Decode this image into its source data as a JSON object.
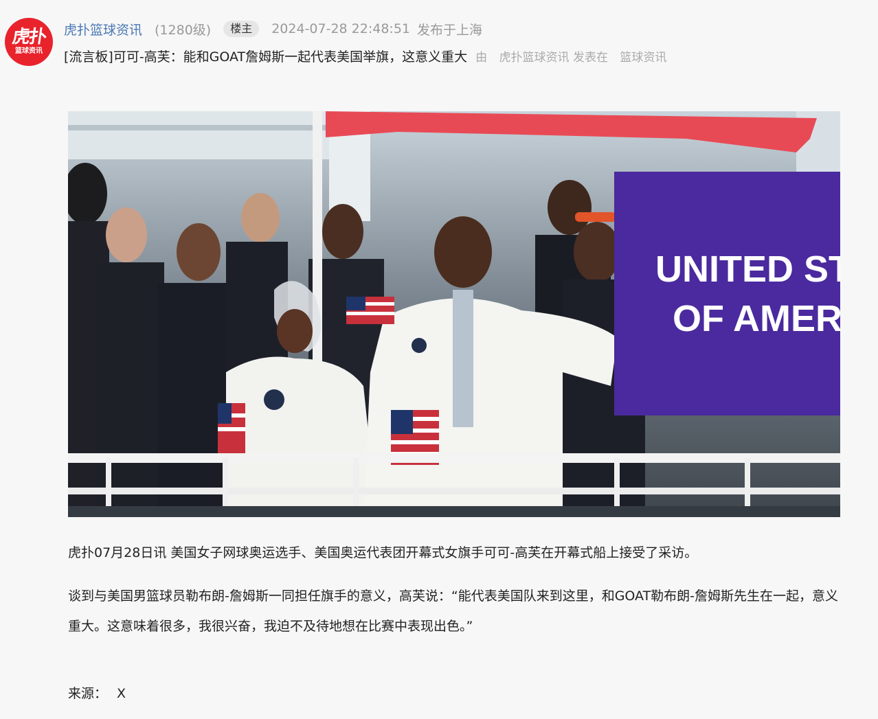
{
  "header": {
    "avatar": {
      "logo_big": "虎扑",
      "logo_small": "篮球资讯",
      "color": "#e8232c"
    },
    "username": "虎扑篮球资讯",
    "level": "(1280级)",
    "op_badge": "楼主",
    "datetime": "2024-07-28 22:48:51",
    "location": "发布于上海"
  },
  "title_row": {
    "title": "[流言板]可可-高芙：能和GOAT詹姆斯一起代表美国举旗，这意义重大",
    "by_prefix": "由",
    "author": "虎扑篮球资讯",
    "posted_in": "发表在",
    "board": "篮球资讯"
  },
  "photo": {
    "banner_line1": "UNITED STA",
    "banner_line2": "OF AMERI",
    "banner_color": "#4a2a9e"
  },
  "body": {
    "p1": "虎扑07月28日讯 美国女子网球奥运选手、美国奥运代表团开幕式女旗手可可-高芙在开幕式船上接受了采访。",
    "p2": "谈到与美国男篮球员勒布朗-詹姆斯一同担任旗手的意义，高芙说：“能代表美国队来到这里，和GOAT勒布朗-詹姆斯先生在一起，意义重大。这意味着很多，我很兴奋，我迫不及待地想在比赛中表现出色。”",
    "source_label": "来源：",
    "source_value": "X"
  },
  "colors": {
    "username_blue": "#4a78b5",
    "muted_gray": "#999999",
    "page_bg": "#f7f7f8"
  }
}
